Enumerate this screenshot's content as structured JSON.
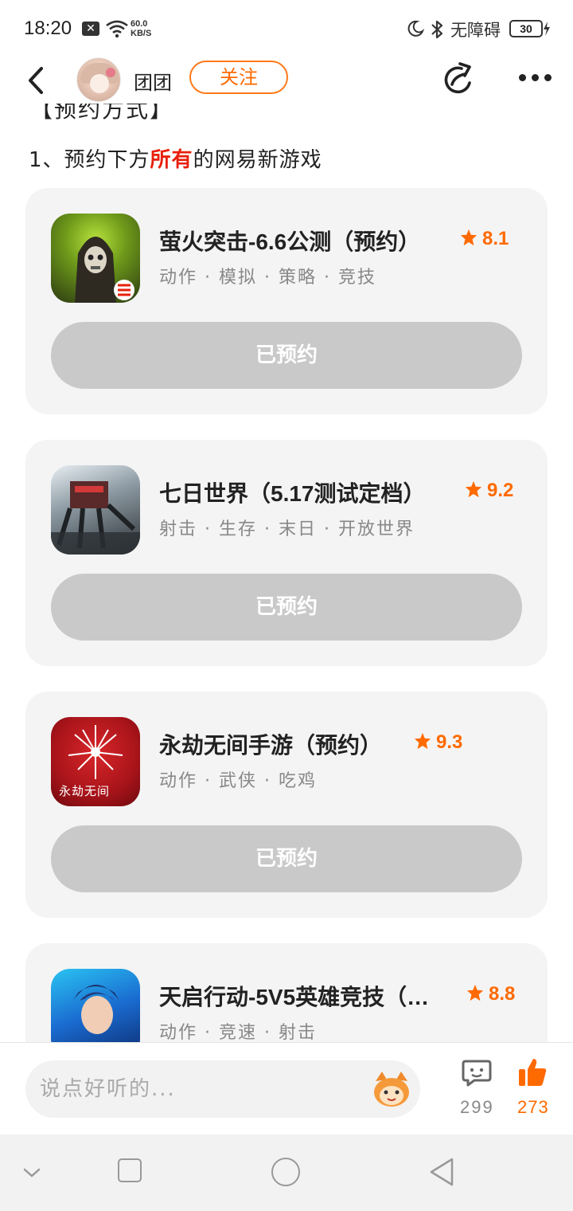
{
  "status_bar": {
    "time": "18:20",
    "notification_badge": "✕",
    "net_speed_value": "60.0",
    "net_speed_unit": "KB/S",
    "accessibility_label": "无障碍",
    "battery": "30"
  },
  "header": {
    "author_name": "团团",
    "follow_label": "关注"
  },
  "post": {
    "cut_heading": "【预约方式】",
    "intro_prefix": "1、预约下方",
    "intro_highlight": "所有",
    "intro_suffix": "的网易新游戏"
  },
  "games": [
    {
      "title": "萤火突击-6.6公测（预约）",
      "rating": "8.1",
      "tags": "动作 · 模拟 · 策略 · 竞技",
      "button_label": "已预约",
      "icon": "game-icon-soldier"
    },
    {
      "title": "七日世界（5.17测试定档）",
      "rating": "9.2",
      "tags": "射击 · 生存 · 末日 · 开放世界",
      "button_label": "已预约",
      "icon": "game-icon-monster"
    },
    {
      "title": "永劫无间手游（预约）",
      "rating": "9.3",
      "tags": "动作 · 武侠 · 吃鸡",
      "button_label": "已预约",
      "icon": "game-icon-red-flower",
      "icon_text": "永劫无间"
    },
    {
      "title": "天启行动-5V5英雄竞技（…",
      "rating": "8.8",
      "tags": "动作 · 竞速 · 射击",
      "icon": "game-icon-hero"
    }
  ],
  "comment_bar": {
    "placeholder": "说点好听的...",
    "comment_count": "299",
    "like_count": "273"
  },
  "colors": {
    "accent": "#ff6a00",
    "highlight_red": "#e8200c",
    "card_bg": "#f4f4f4",
    "button_disabled": "#c9c9c9"
  }
}
